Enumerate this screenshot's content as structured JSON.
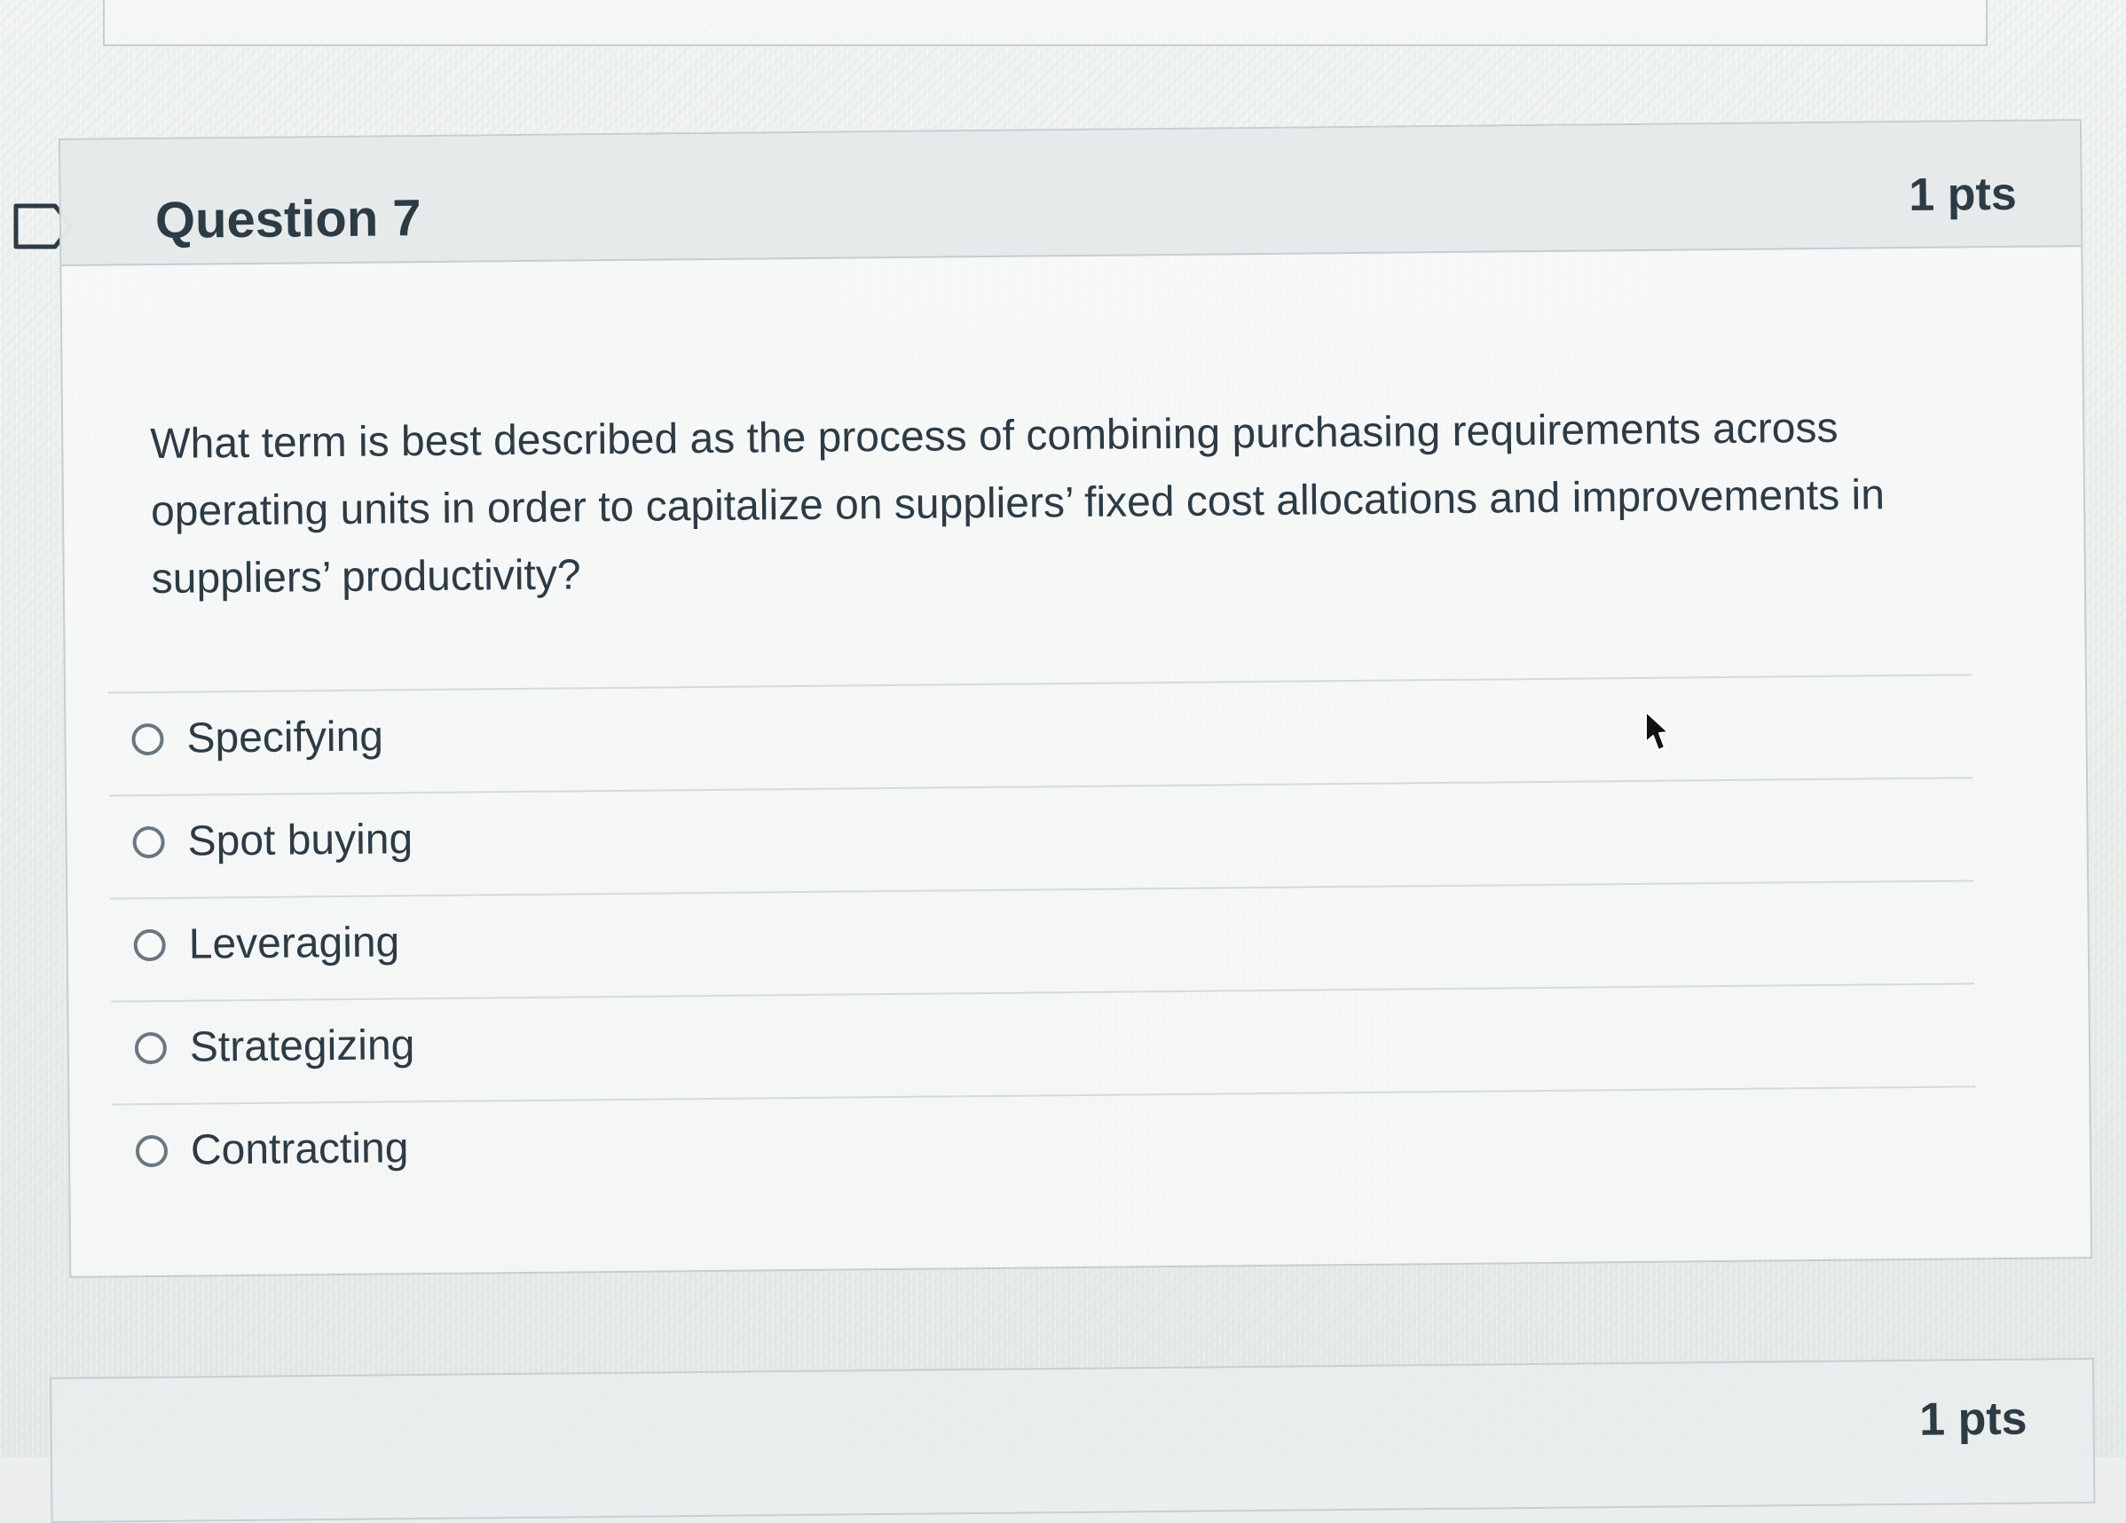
{
  "question": {
    "title": "Question 7",
    "points": "1 pts",
    "text": "What term is best described as the process of combining purchasing requirements across operating units in order to capitalize on suppliers’ fixed cost allocations and improvements in suppliers’ productivity?"
  },
  "answers": [
    "Specifying",
    "Spot buying",
    "Leveraging",
    "Strategizing",
    "Contracting"
  ],
  "next_question": {
    "points": "1 pts"
  },
  "colors": {
    "text": "#2d3b45",
    "border": "#c6cdd1",
    "header": "#e5e8e9"
  },
  "icons": {
    "flag": "flag-icon",
    "cursor": "cursor-icon",
    "radio": "radio-icon"
  }
}
